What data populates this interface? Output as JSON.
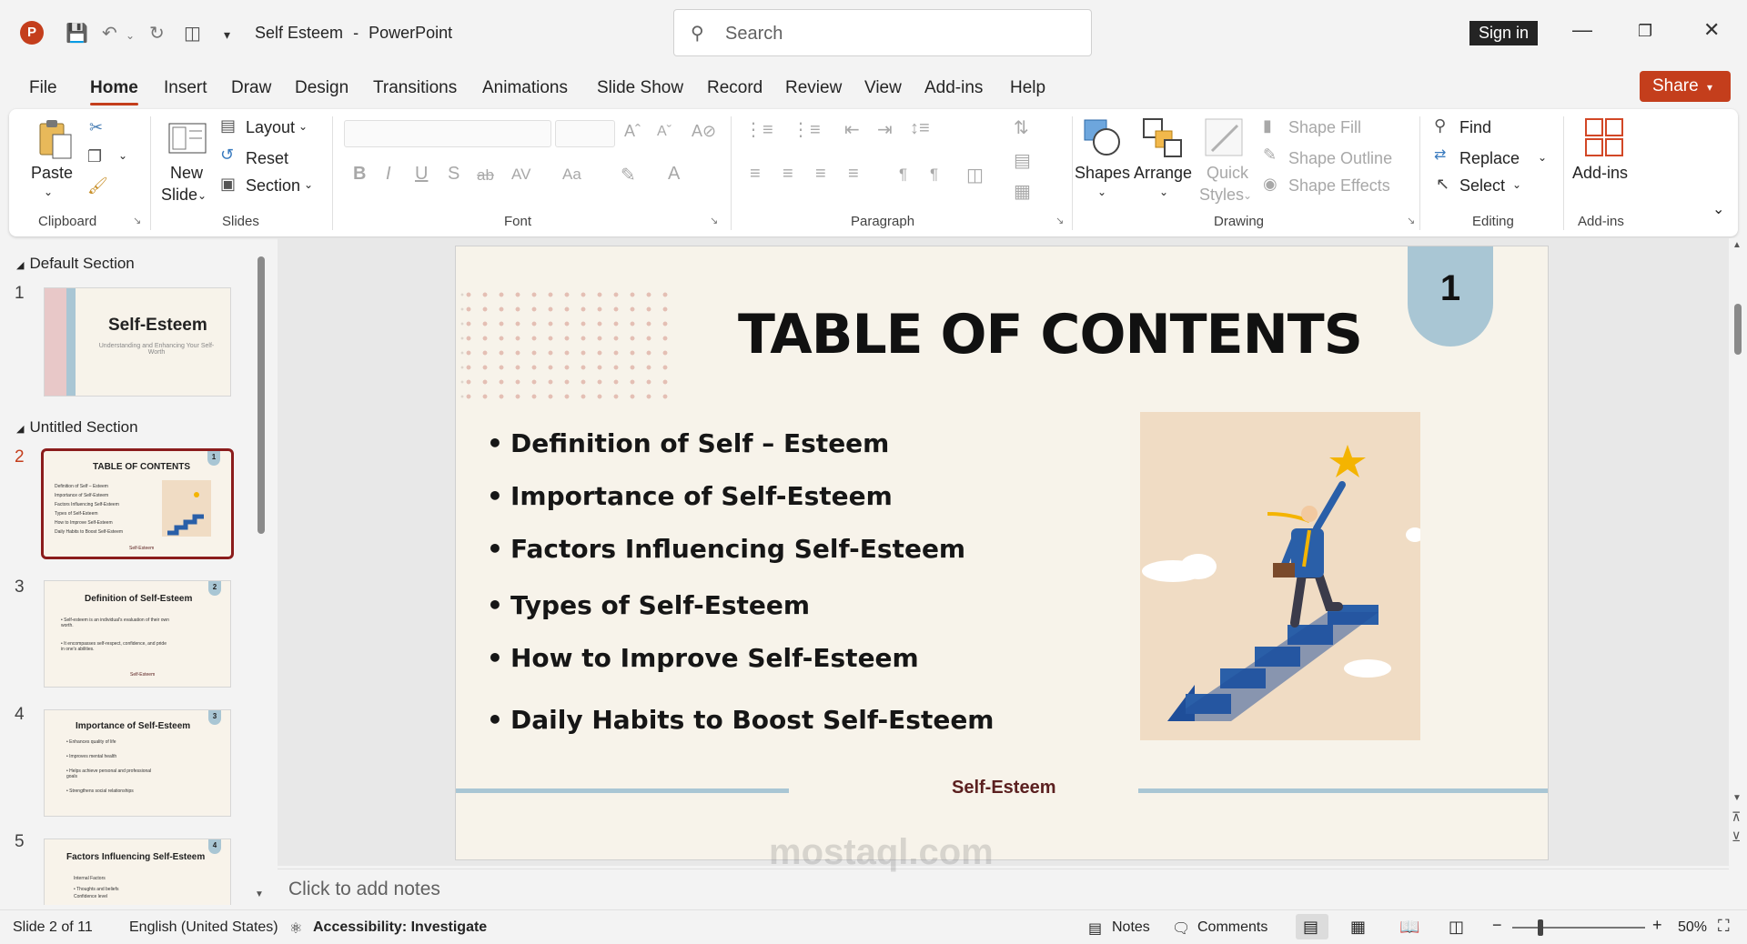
{
  "app": {
    "document_title": "Self Esteem",
    "app_name": "PowerPoint",
    "title_sep": "-",
    "search_placeholder": "Search",
    "sign_in": "Sign in",
    "share": "Share",
    "logo_letter": "P"
  },
  "menu": [
    "File",
    "Home",
    "Insert",
    "Draw",
    "Design",
    "Transitions",
    "Animations",
    "Slide Show",
    "Record",
    "Review",
    "View",
    "Add-ins",
    "Help"
  ],
  "ribbon": {
    "clipboard": {
      "paste": "Paste",
      "label": "Clipboard"
    },
    "slides": {
      "new_slide_1": "New",
      "new_slide_2": "Slide",
      "layout": "Layout",
      "reset": "Reset",
      "section": "Section",
      "label": "Slides"
    },
    "font": {
      "label": "Font"
    },
    "paragraph": {
      "label": "Paragraph"
    },
    "drawing": {
      "shapes": "Shapes",
      "arrange": "Arrange",
      "quick_1": "Quick",
      "quick_2": "Styles",
      "shape_fill": "Shape Fill",
      "shape_outline": "Shape Outline",
      "shape_effects": "Shape Effects",
      "label": "Drawing"
    },
    "editing": {
      "find": "Find",
      "replace": "Replace",
      "select": "Select",
      "label": "Editing"
    },
    "addins": {
      "addins": "Add-ins",
      "label": "Add-ins"
    }
  },
  "thumbnails": {
    "section1": "Default Section",
    "section2": "Untitled Section",
    "slides": [
      {
        "num": "1",
        "title": "Self-Esteem",
        "subtitle": "Understanding and Enhancing Your Self-Worth"
      },
      {
        "num": "2",
        "title": "TABLE OF CONTENTS",
        "badge": "1",
        "lines": [
          "Definition of Self – Esteem",
          "Importance of Self-Esteem",
          "Factors Influencing Self-Esteem",
          "Types of Self-Esteem",
          "How to Improve Self-Esteem",
          "Daily Habits to Boost Self-Esteem"
        ],
        "footer": "Self-Esteem"
      },
      {
        "num": "3",
        "title": "Definition of Self-Esteem",
        "badge": "2",
        "lines": [
          "• Self-esteem is an individual's evaluation of their own worth.",
          "• It encompasses self-respect, confidence, and pride in one's abilities."
        ],
        "footer": "Self-Esteem"
      },
      {
        "num": "4",
        "title": "Importance of Self-Esteem",
        "badge": "3",
        "lines": [
          "• Enhances quality of life",
          "• Improves mental health",
          "• Helps achieve personal and professional goals",
          "• Strengthens social relationships"
        ]
      },
      {
        "num": "5",
        "title": "Factors Influencing Self-Esteem",
        "badge": "4",
        "lines": [
          "Internal Factors",
          "• Thoughts and beliefs",
          "Confidence level"
        ]
      }
    ]
  },
  "slide": {
    "title": "TABLE OF CONTENTS",
    "badge": "1",
    "bullets": [
      "Definition of Self – Esteem",
      "Importance of Self-Esteem",
      "Factors Influencing Self-Esteem",
      "Types of Self-Esteem",
      "How to Improve Self-Esteem",
      "Daily Habits to Boost Self-Esteem"
    ],
    "footer": "Self-Esteem"
  },
  "notes_placeholder": "Click to add notes",
  "status": {
    "slide_info": "Slide 2 of 11",
    "language": "English (United States)",
    "accessibility": "Accessibility: Investigate",
    "notes": "Notes",
    "comments": "Comments",
    "zoom": "50%"
  },
  "watermark": "mostaql.com",
  "colors": {
    "accent": "#c43e1c",
    "slide_bg": "#f7f3ea",
    "badge": "#a9c6d4",
    "selected_border": "#8b1c1c"
  }
}
